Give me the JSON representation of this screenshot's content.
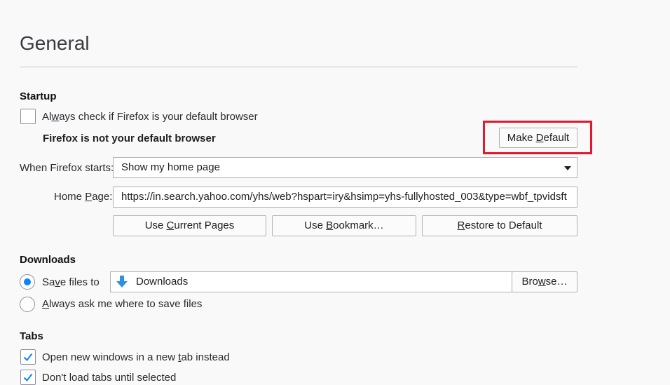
{
  "page": {
    "title": "General"
  },
  "startup": {
    "section_title": "Startup",
    "always_check_label_pre": "Al",
    "always_check_label_u": "w",
    "always_check_label_post": "ays check if Firefox is your default browser",
    "always_check_checked": false,
    "not_default_message": "Firefox is not your default browser",
    "make_default_pre": "Make ",
    "make_default_u": "D",
    "make_default_post": "efault",
    "when_starts_label": "When Firefox starts:",
    "when_starts_value": "Show my home page",
    "home_page_label_pre": "Home ",
    "home_page_label_u": "P",
    "home_page_label_post": "age:",
    "home_page_value": "https://in.search.yahoo.com/yhs/web?hspart=iry&hsimp=yhs-fullyhosted_003&type=wbf_tpvidsft",
    "use_current_pre": "Use ",
    "use_current_u": "C",
    "use_current_post": "urrent Pages",
    "use_bookmark_pre": "Use ",
    "use_bookmark_u": "B",
    "use_bookmark_post": "ookmark…",
    "restore_default_pre": "",
    "restore_default_u": "R",
    "restore_default_post": "estore to Default"
  },
  "downloads": {
    "section_title": "Downloads",
    "save_files_pre": "Sa",
    "save_files_u": "v",
    "save_files_post": "e files to",
    "save_files_selected": true,
    "folder_name": "Downloads",
    "browse_pre": "Bro",
    "browse_u": "w",
    "browse_post": "se…",
    "always_ask_pre": "",
    "always_ask_u": "A",
    "always_ask_post": "lways ask me where to save files",
    "always_ask_selected": false
  },
  "tabs": {
    "section_title": "Tabs",
    "open_new_windows_pre": "Open new windows in a new ",
    "open_new_windows_u": "t",
    "open_new_windows_post": "ab instead",
    "open_new_windows_checked": true,
    "dont_load_tabs": "Don't load tabs until selected",
    "dont_load_tabs_checked": true
  },
  "colors": {
    "accent": "#0a84ff",
    "highlight": "#e2192e",
    "download_arrow": "#2f8fe0"
  }
}
